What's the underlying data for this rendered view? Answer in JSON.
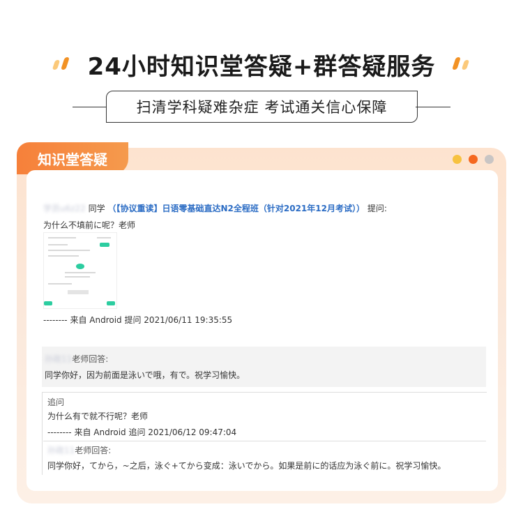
{
  "header": {
    "title": "24小时知识堂答疑+群答疑服务",
    "subtitle": "扫清学科疑难杂症 考试通关信心保障"
  },
  "panel": {
    "tab_label": "知识堂答疑"
  },
  "question": {
    "user": "学员u6z22",
    "user_suffix": "同学",
    "course": "（【协议重读】日语零基础直达N2全程班（针对2021年12月考试））",
    "asked_label": "提问:",
    "text": "为什么不填前に呢？老师",
    "meta": "-------- 来自 Android 提问 2021/06/11 19:35:55"
  },
  "answer1": {
    "teacher": "孙政11",
    "label": "老师回答:",
    "text": "同学你好，因为前面是泳いで哦，有で。祝学习愉快。"
  },
  "followup": {
    "label": "追问",
    "text": "为什么有で就不行呢？老师",
    "meta": "-------- 来自 Android 追问 2021/06/12 09:47:04"
  },
  "answer2": {
    "teacher": "孙政11",
    "label": "老师回答:",
    "text": "同学你好，てから，~之后，泳ぐ+てから变成：泳いでから。如果是前に的话应为泳ぐ前に。祝学习愉快。"
  },
  "colors": {
    "accent": "#f6803a",
    "link": "#2b6cc4",
    "dot_yellow": "#f7c240",
    "dot_orange": "#f5681f",
    "dot_grey": "#c9c5c4"
  }
}
